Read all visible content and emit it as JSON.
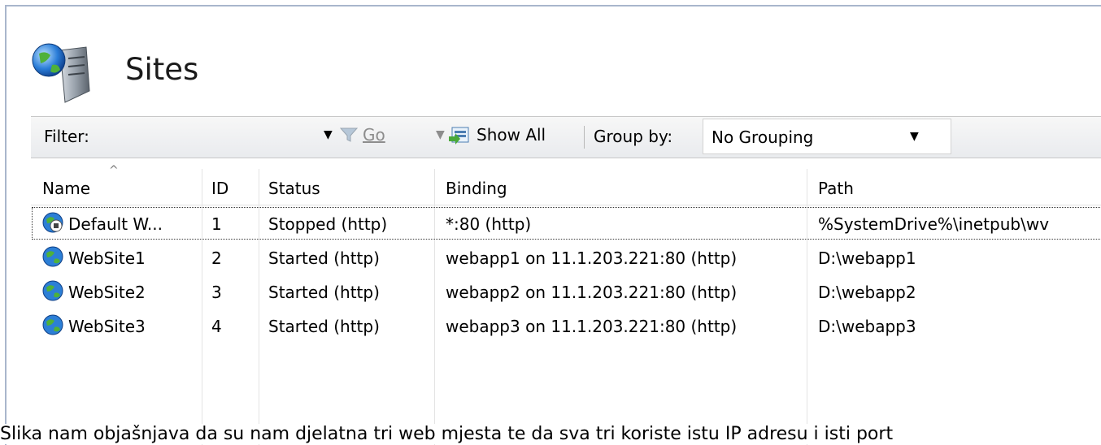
{
  "header": {
    "title": "Sites",
    "icon": "server-globe-icon"
  },
  "toolbar": {
    "filter_label": "Filter:",
    "filter_value": "",
    "go_label": "Go",
    "show_all_label": "Show All",
    "group_by_label": "Group by:",
    "group_by_value": "No Grouping"
  },
  "table": {
    "columns": [
      "Name",
      "ID",
      "Status",
      "Binding",
      "Path"
    ],
    "rows": [
      {
        "name": "Default W...",
        "id": "1",
        "status": "Stopped (http)",
        "binding": "*:80 (http)",
        "path": "%SystemDrive%\\inetpub\\wv",
        "icon": "stopped-globe-icon",
        "selected": true
      },
      {
        "name": "WebSite1",
        "id": "2",
        "status": "Started (http)",
        "binding": "webapp1 on 11.1.203.221:80 (http)",
        "path": "D:\\webapp1",
        "icon": "globe-icon"
      },
      {
        "name": "WebSite2",
        "id": "3",
        "status": "Started (http)",
        "binding": "webapp2 on 11.1.203.221:80 (http)",
        "path": "D:\\webapp2",
        "icon": "globe-icon"
      },
      {
        "name": "WebSite3",
        "id": "4",
        "status": "Started (http)",
        "binding": "webapp3 on 11.1.203.221:80 (http)",
        "path": "D:\\webapp3",
        "icon": "globe-icon"
      }
    ]
  },
  "caption": "Slika nam objašnjava da su nam djelatna tri web mjesta te da sva tri koriste istu IP adresu i isti port",
  "colors": {
    "border": "#a9b6cc",
    "toolbar_bg": "#eceef1",
    "disabled": "#8d8d8d"
  }
}
